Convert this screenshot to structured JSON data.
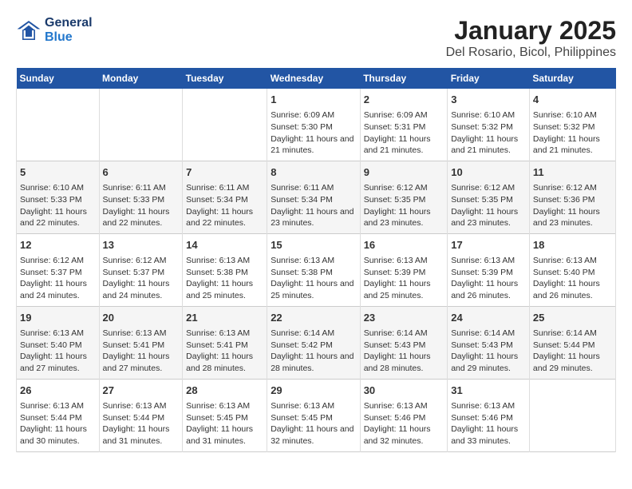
{
  "header": {
    "logo_line1": "General",
    "logo_line2": "Blue",
    "title": "January 2025",
    "subtitle": "Del Rosario, Bicol, Philippines"
  },
  "days_of_week": [
    "Sunday",
    "Monday",
    "Tuesday",
    "Wednesday",
    "Thursday",
    "Friday",
    "Saturday"
  ],
  "weeks": [
    [
      {
        "day": "",
        "text": ""
      },
      {
        "day": "",
        "text": ""
      },
      {
        "day": "",
        "text": ""
      },
      {
        "day": "1",
        "text": "Sunrise: 6:09 AM\nSunset: 5:30 PM\nDaylight: 11 hours and 21 minutes."
      },
      {
        "day": "2",
        "text": "Sunrise: 6:09 AM\nSunset: 5:31 PM\nDaylight: 11 hours and 21 minutes."
      },
      {
        "day": "3",
        "text": "Sunrise: 6:10 AM\nSunset: 5:32 PM\nDaylight: 11 hours and 21 minutes."
      },
      {
        "day": "4",
        "text": "Sunrise: 6:10 AM\nSunset: 5:32 PM\nDaylight: 11 hours and 21 minutes."
      }
    ],
    [
      {
        "day": "5",
        "text": "Sunrise: 6:10 AM\nSunset: 5:33 PM\nDaylight: 11 hours and 22 minutes."
      },
      {
        "day": "6",
        "text": "Sunrise: 6:11 AM\nSunset: 5:33 PM\nDaylight: 11 hours and 22 minutes."
      },
      {
        "day": "7",
        "text": "Sunrise: 6:11 AM\nSunset: 5:34 PM\nDaylight: 11 hours and 22 minutes."
      },
      {
        "day": "8",
        "text": "Sunrise: 6:11 AM\nSunset: 5:34 PM\nDaylight: 11 hours and 23 minutes."
      },
      {
        "day": "9",
        "text": "Sunrise: 6:12 AM\nSunset: 5:35 PM\nDaylight: 11 hours and 23 minutes."
      },
      {
        "day": "10",
        "text": "Sunrise: 6:12 AM\nSunset: 5:35 PM\nDaylight: 11 hours and 23 minutes."
      },
      {
        "day": "11",
        "text": "Sunrise: 6:12 AM\nSunset: 5:36 PM\nDaylight: 11 hours and 23 minutes."
      }
    ],
    [
      {
        "day": "12",
        "text": "Sunrise: 6:12 AM\nSunset: 5:37 PM\nDaylight: 11 hours and 24 minutes."
      },
      {
        "day": "13",
        "text": "Sunrise: 6:12 AM\nSunset: 5:37 PM\nDaylight: 11 hours and 24 minutes."
      },
      {
        "day": "14",
        "text": "Sunrise: 6:13 AM\nSunset: 5:38 PM\nDaylight: 11 hours and 25 minutes."
      },
      {
        "day": "15",
        "text": "Sunrise: 6:13 AM\nSunset: 5:38 PM\nDaylight: 11 hours and 25 minutes."
      },
      {
        "day": "16",
        "text": "Sunrise: 6:13 AM\nSunset: 5:39 PM\nDaylight: 11 hours and 25 minutes."
      },
      {
        "day": "17",
        "text": "Sunrise: 6:13 AM\nSunset: 5:39 PM\nDaylight: 11 hours and 26 minutes."
      },
      {
        "day": "18",
        "text": "Sunrise: 6:13 AM\nSunset: 5:40 PM\nDaylight: 11 hours and 26 minutes."
      }
    ],
    [
      {
        "day": "19",
        "text": "Sunrise: 6:13 AM\nSunset: 5:40 PM\nDaylight: 11 hours and 27 minutes."
      },
      {
        "day": "20",
        "text": "Sunrise: 6:13 AM\nSunset: 5:41 PM\nDaylight: 11 hours and 27 minutes."
      },
      {
        "day": "21",
        "text": "Sunrise: 6:13 AM\nSunset: 5:41 PM\nDaylight: 11 hours and 28 minutes."
      },
      {
        "day": "22",
        "text": "Sunrise: 6:14 AM\nSunset: 5:42 PM\nDaylight: 11 hours and 28 minutes."
      },
      {
        "day": "23",
        "text": "Sunrise: 6:14 AM\nSunset: 5:43 PM\nDaylight: 11 hours and 28 minutes."
      },
      {
        "day": "24",
        "text": "Sunrise: 6:14 AM\nSunset: 5:43 PM\nDaylight: 11 hours and 29 minutes."
      },
      {
        "day": "25",
        "text": "Sunrise: 6:14 AM\nSunset: 5:44 PM\nDaylight: 11 hours and 29 minutes."
      }
    ],
    [
      {
        "day": "26",
        "text": "Sunrise: 6:13 AM\nSunset: 5:44 PM\nDaylight: 11 hours and 30 minutes."
      },
      {
        "day": "27",
        "text": "Sunrise: 6:13 AM\nSunset: 5:44 PM\nDaylight: 11 hours and 31 minutes."
      },
      {
        "day": "28",
        "text": "Sunrise: 6:13 AM\nSunset: 5:45 PM\nDaylight: 11 hours and 31 minutes."
      },
      {
        "day": "29",
        "text": "Sunrise: 6:13 AM\nSunset: 5:45 PM\nDaylight: 11 hours and 32 minutes."
      },
      {
        "day": "30",
        "text": "Sunrise: 6:13 AM\nSunset: 5:46 PM\nDaylight: 11 hours and 32 minutes."
      },
      {
        "day": "31",
        "text": "Sunrise: 6:13 AM\nSunset: 5:46 PM\nDaylight: 11 hours and 33 minutes."
      },
      {
        "day": "",
        "text": ""
      }
    ]
  ]
}
